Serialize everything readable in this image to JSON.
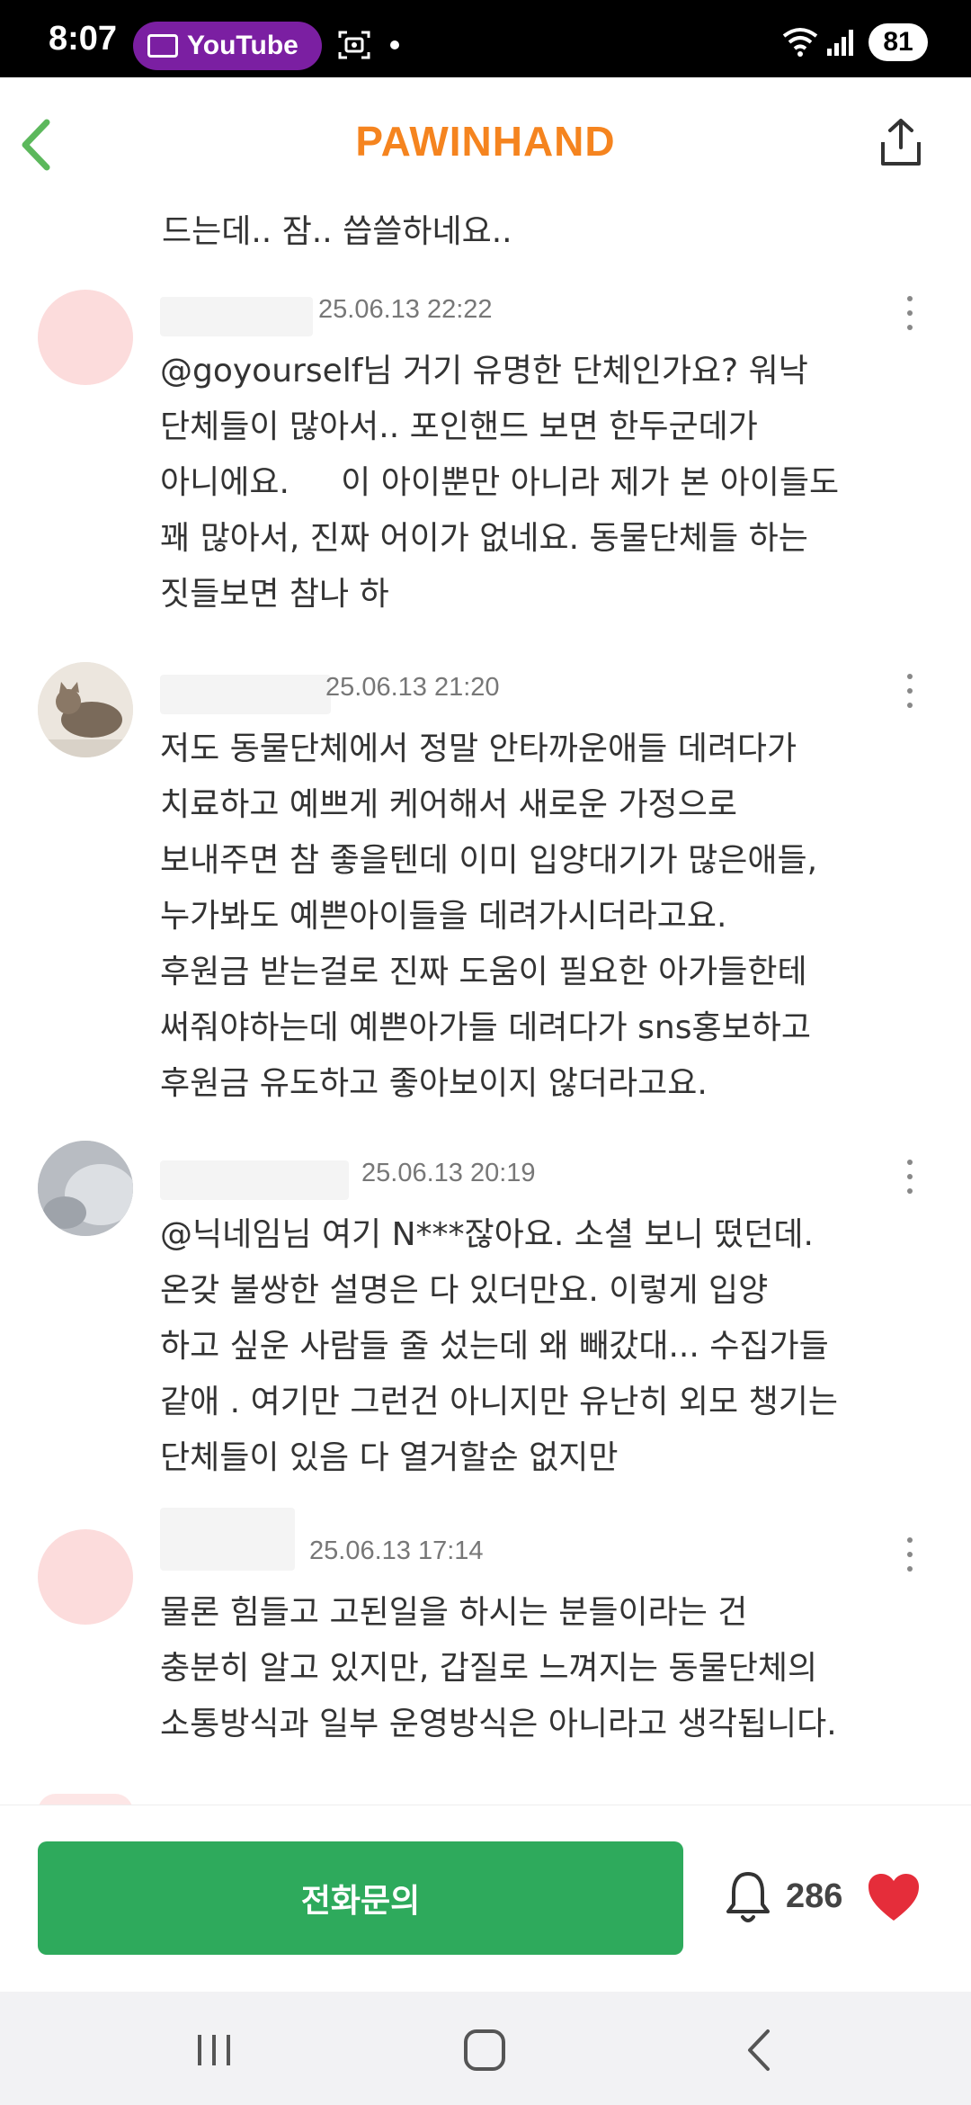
{
  "status_bar": {
    "time": "8:07",
    "app_pill": "YouTube",
    "battery": "81",
    "icons": [
      "youtube-screen-icon",
      "screen-record-icon",
      "notification-dot-icon",
      "wifi-icon",
      "signal-icon",
      "battery-icon"
    ]
  },
  "header": {
    "brand": "PAWINHAND",
    "back_icon": "chevron-left-icon",
    "share_icon": "share-icon",
    "colors": {
      "brand": "#f5841f",
      "back": "#5cb85c"
    }
  },
  "comments": {
    "first_line": "드는데.. 잠.. 씁쓸하네요..",
    "items": [
      {
        "timestamp": "25.06.13 22:22",
        "text": "@goyourself님 거기 유명한 단체인가요? 워낙\n단체들이 많아서.. 포인핸드 보면 한두군데가\n아니에요.     이 아이뿐만 아니라 제가 본 아이들도\n꽤 많아서, 진짜 어이가 없네요. 동물단체들 하는\n짓들보면 참나 하"
      },
      {
        "timestamp": "25.06.13 21:20",
        "text": "저도 동물단체에서 정말 안타까운애들 데려다가\n치료하고 예쁘게 케어해서 새로운 가정으로\n보내주면 참 좋을텐데 이미 입양대기가 많은애들,\n누가봐도 예쁜아이들을 데려가시더라고요.\n후원금 받는걸로 진짜 도움이 필요한 아가들한테\n써줘야하는데 예쁜아가들 데려다가 sns홍보하고\n후원금 유도하고 좋아보이지 않더라고요."
      },
      {
        "timestamp": "25.06.13 20:19",
        "text": "@닉네임님 여기 N***잖아요. 소셜 보니 떴던데.\n온갖 불쌍한 설명은 다 있더만요. 이렇게 입양\n하고 싶운 사람들 줄 섰는데 왜 빼갔대... 수집가들\n같애 . 여기만 그런건 아니지만 유난히 외모 챙기는\n단체들이 있음 다 열거할순 없지만"
      },
      {
        "timestamp": "25.06.13 17:14",
        "text": "물론 힘들고 고된일을 하시는 분들이라는 건\n충분히 알고 있지만, 갑질로 느껴지는 동물단체의\n소통방식과 일부 운영방식은 아니라고 생각됩니다."
      }
    ]
  },
  "bottom_bar": {
    "call_button": "전화문의",
    "like_count": "286",
    "colors": {
      "call_button": "#2eaa5c",
      "heart": "#e52d3a"
    }
  },
  "nav_bar": {
    "icons": [
      "recent-apps-icon",
      "home-icon",
      "back-icon"
    ]
  }
}
